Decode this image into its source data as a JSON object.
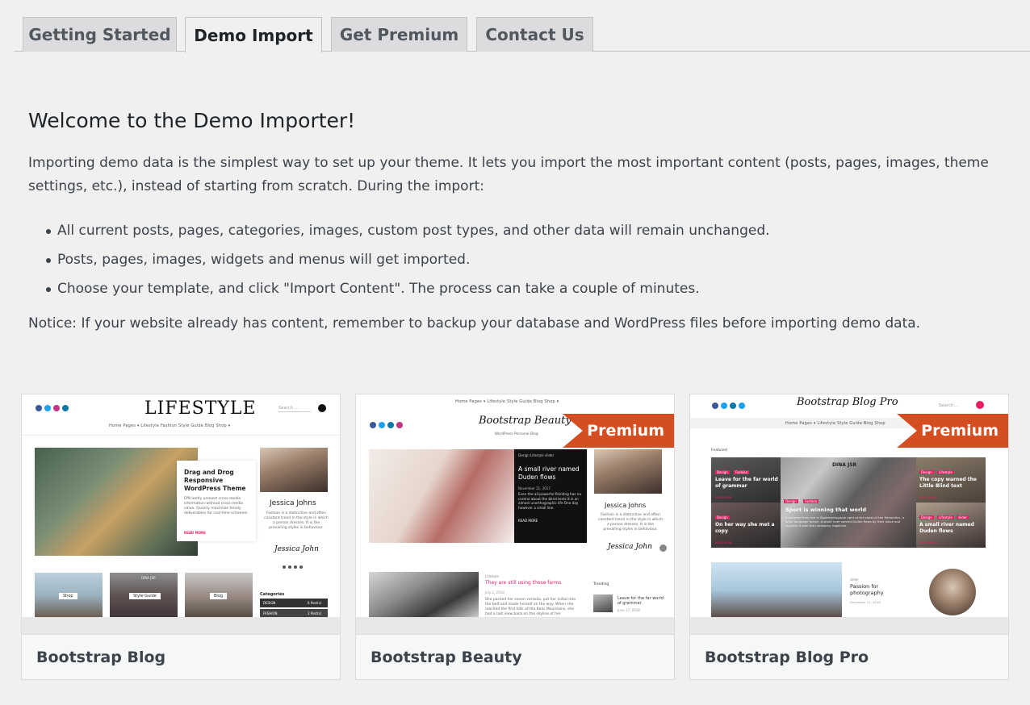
{
  "tabs": [
    {
      "label": "Getting Started",
      "active": false
    },
    {
      "label": "Demo Import",
      "active": true
    },
    {
      "label": "Get Premium",
      "active": false
    },
    {
      "label": "Contact Us",
      "active": false
    }
  ],
  "intro": {
    "title": "Welcome to the Demo Importer!",
    "lead": "Importing demo data is the simplest way to set up your theme. It lets you import the most important content (posts, pages, images, theme settings, etc.), instead of starting from scratch. During the import:",
    "bullets": [
      "All current posts, pages, categories, images, custom post types, and other data will remain unchanged.",
      "Posts, pages, images, widgets and menus will get imported.",
      "Choose your template, and click \"Import Content\". The process can take a couple of minutes."
    ],
    "notice": "Notice: If your website already has content, remember to backup your database and WordPress files before importing demo data."
  },
  "colors": {
    "premium": "#d54e21",
    "tag_pink": "#e91e63"
  },
  "demos": [
    {
      "title": "Bootstrap Blog",
      "premium": false,
      "preview": {
        "logo": "LIFESTYLE",
        "search_placeholder": "Search ...",
        "menu": "Home    Pages ▾    Lifestyle    Fashion    Style Guide    Blog    Shop ▾",
        "hero_heading": "Drag and Drog Responsive WordPress Theme",
        "hero_text": "Efficiently unleash cross-media information without cross-media value. Quickly maximize timely deliverables for real-time schemes.",
        "read_more": "READ MORE",
        "author_name": "Jessica Johns",
        "author_text": "Fashion is a distinctive and often constant trend in the style in which a person dresses. It is the prevailing styles in behaviour.",
        "signature": "Jessica John",
        "thumbs": [
          "Shop",
          "Style Guide",
          "Blog"
        ],
        "categories_heading": "Categories",
        "categories": [
          {
            "name": "DESIGN",
            "count": "6 Post(s)"
          },
          {
            "name": "FASHION",
            "count": "2 Post(s)"
          }
        ],
        "dina_label": "DINA JSR"
      }
    },
    {
      "title": "Bootstrap Beauty",
      "premium": true,
      "badge": "Premium",
      "preview": {
        "menu": "Home    Pages ▾    Lifestyle    Style Guide    Blog    Shop ▾",
        "logo": "Bootstrap Beauty",
        "tagline": "WordPress Personal Blog",
        "post_tags": "Design   Lifestyle   slider",
        "post_heading": "A small river named Duden flows",
        "post_date": "November 21, 2017",
        "post_text": "Even the all-powerful Pointing has no control about the blind texts it is an almost unorthographic life One day however a small line.",
        "read_more": "READ MORE",
        "author_name": "Jessica Johns",
        "author_text": "Fashion is a distinctive and often constant trend in the style in which a person dresses. It is the prevailing styles in behaviour.",
        "signature": "Jessica John",
        "lower_tag": "Lifestyle",
        "lower_heading": "They are still using those farms",
        "lower_date": "July 2, 2018",
        "lower_text": "She packed her seven versalia, put her initial into the belt and made herself on the way. When she reached the first hills of the Italic Mountains, she had a last view back on the skyline of her hometown",
        "trending_heading": "Trending",
        "trending_title": "Leave for the far world of grammar",
        "trending_date": "June 17, 2018"
      }
    },
    {
      "title": "Bootstrap Blog Pro",
      "premium": true,
      "badge": "Premium",
      "preview": {
        "logo": "Bootstrap Blog Pro",
        "search_placeholder": "Search ...",
        "menu": "Home    Pages ▾    Lifestyle    Style Guide    Blog    Shop",
        "featured": "Featured",
        "grid": [
          {
            "tags": [
              "Design",
              "Fashion"
            ],
            "title": "Leave for the far world of grammar",
            "more": "READ MORE"
          },
          {
            "tags": [
              "Design",
              "Fashion"
            ],
            "title": "Sport is winning that world",
            "more": ""
          },
          {
            "tags": [
              "Design",
              "Lifestyle"
            ],
            "title": "The copy warned the Little Blind text",
            "more": "READ MORE"
          },
          {
            "tags": [
              "Design"
            ],
            "title": "On her way she met a copy",
            "more": "READ MORE"
          },
          {
            "tags": [
              "Design",
              "Lifestyle",
              "slider"
            ],
            "title": "A small river named Duden flows",
            "more": "READ MORE"
          }
        ],
        "center_text": "Separated they live in Bookmarksgrove right at the coast of the Semantics, a large language ocean. A small river named Duden flows by their place and supplies it with the necessary regelialia.",
        "dina_label": "DINA JSR",
        "lower_tag": "slider",
        "lower_heading": "Passion for photography",
        "lower_date": "December 21, 2018"
      }
    }
  ]
}
